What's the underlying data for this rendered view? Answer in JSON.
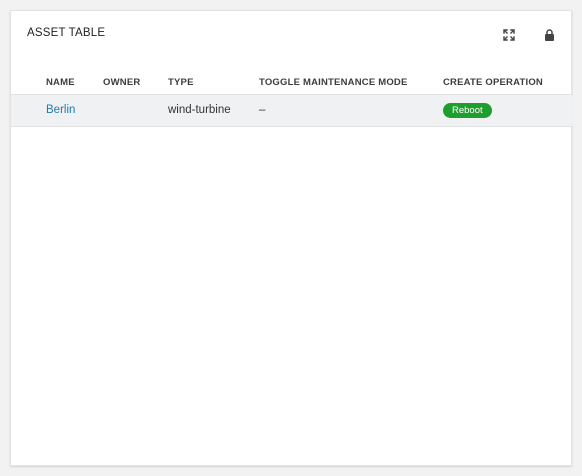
{
  "widget": {
    "title": "ASSET TABLE",
    "icons": {
      "expand": "expand-icon",
      "lock": "lock-icon"
    }
  },
  "table": {
    "columns": [
      "NAME",
      "OWNER",
      "TYPE",
      "TOGGLE MAINTENANCE MODE",
      "CREATE OPERATION"
    ],
    "rows": [
      {
        "name": "Berlin",
        "owner": "",
        "type": "wind-turbine",
        "maintenance": "–",
        "operation": "Reboot"
      }
    ]
  },
  "colors": {
    "link": "#1b7bb0",
    "badge": "#1e9e2d",
    "row_background": "#f0f1f3"
  }
}
